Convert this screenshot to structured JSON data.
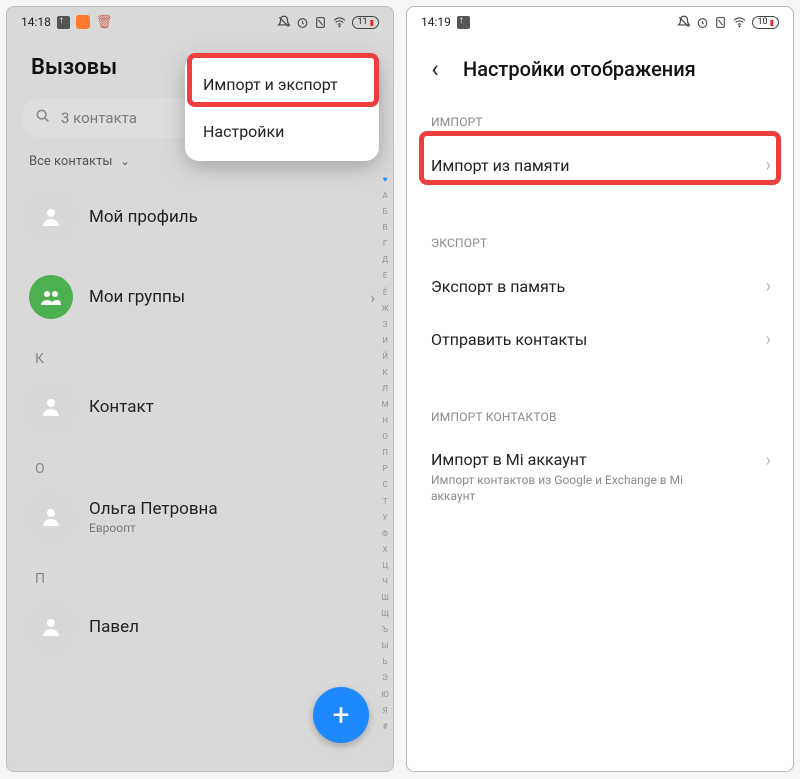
{
  "left": {
    "status": {
      "time": "14:18",
      "battery": "11"
    },
    "title": "Вызовы",
    "search_placeholder": "3 контакта",
    "filter_label": "Все контакты",
    "popup": {
      "item1": "Импорт и экспорт",
      "item2": "Настройки"
    },
    "rows": {
      "profile": "Мой профиль",
      "groups": "Мои группы",
      "section_K": "К",
      "contact_k": "Контакт",
      "section_O": "О",
      "contact_o_name": "Ольга Петровна",
      "contact_o_sub": "Евроопт",
      "section_P": "П",
      "contact_p": "Павел"
    },
    "az": [
      "♥",
      "А",
      "Б",
      "В",
      "Г",
      "Д",
      "Е",
      "Ё",
      "Ж",
      "З",
      "И",
      "Й",
      "К",
      "Л",
      "М",
      "Н",
      "О",
      "П",
      "Р",
      "С",
      "Т",
      "У",
      "Ф",
      "Х",
      "Ц",
      "Ч",
      "Ш",
      "Щ",
      "Ъ",
      "Ы",
      "Ь",
      "Э",
      "Ю",
      "Я",
      "#"
    ]
  },
  "right": {
    "status": {
      "time": "14:19",
      "battery": "10"
    },
    "title": "Настройки отображения",
    "sections": {
      "import_header": "ИМПОРТ",
      "import_item": "Импорт из памяти",
      "export_header": "ЭКСПОРТ",
      "export_item1": "Экспорт в память",
      "export_item2": "Отправить контакты",
      "importc_header": "ИМПОРТ КОНТАКТОВ",
      "importc_item": "Импорт в Mi аккаунт",
      "importc_sub": "Импорт контактов из Google и Exchange в Mi аккаунт"
    }
  }
}
